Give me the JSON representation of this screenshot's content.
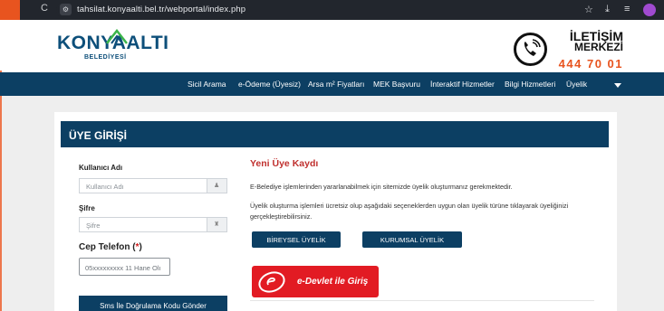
{
  "browser": {
    "url": "tahsilat.konyaalti.bel.tr/webportal/index.php",
    "back_glyph": "→",
    "reload_glyph": "C"
  },
  "header": {
    "logo_text": "KONYAALTI",
    "logo_sub": "BELEDİYESİ",
    "contact_title_1": "İLETİŞİM",
    "contact_title_2": "MERKEZİ",
    "contact_number": "444 70 01"
  },
  "nav": {
    "items": [
      {
        "label": "Sicil Arama"
      },
      {
        "label": "e-Ödeme (Üyesiz)"
      },
      {
        "label": "Arsa m² Fiyatları"
      },
      {
        "label": "MEK Başvuru"
      },
      {
        "label": "İnteraktif Hizmetler"
      },
      {
        "label": "Bilgi Hizmetleri"
      },
      {
        "label": "Üyelik"
      }
    ]
  },
  "login": {
    "panel_title": "ÜYE GİRİŞİ",
    "username_label": "Kullanıcı Adı",
    "username_placeholder": "Kullanıcı Adı",
    "password_label": "Şifre",
    "password_placeholder": "Şifre",
    "phone_label": "Cep Telefon",
    "phone_req_open": "(",
    "phone_req_star": "*",
    "phone_req_close": ")",
    "phone_placeholder": "05xxxxxxxxx 11 Hane Olı",
    "sms_button": "Sms İle Doğrulama Kodu Gönder"
  },
  "register": {
    "title": "Yeni Üye Kaydı",
    "text1": "E-Belediye işlemlerinden yararlanabilmek için sitemizde üyelik oluşturmanız gerekmektedir.",
    "text2a": "Üyelik oluşturma işlemleri ücretsiz olup aşağıdaki seçeneklerden uygun olan üyelik türüne tıklayarak üyeliğinizi",
    "text2b": "gerçekleştirebilirsiniz.",
    "individual_button": "BİREYSEL ÜYELİK",
    "corporate_button": "KURUMSAL ÜYELİK",
    "edevlet_button": "e-Devlet ile Giriş"
  },
  "colors": {
    "brand_navy": "#0c3f63",
    "accent_orange": "#e8541f",
    "title_red": "#c0302e",
    "edevlet_red": "#e21b23"
  },
  "icons": [
    "settings-icon",
    "star-icon",
    "download-icon",
    "media-icon",
    "phone-icon",
    "user-icon",
    "lock-icon",
    "caret-down-icon"
  ]
}
